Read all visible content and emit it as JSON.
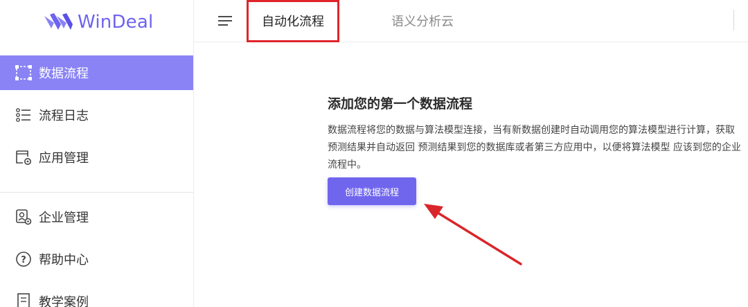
{
  "brand": {
    "name": "WinDeal",
    "color": "#6c63f0"
  },
  "sidebar": {
    "items": [
      {
        "label": "数据流程",
        "icon": "data-flow-icon",
        "active": true
      },
      {
        "label": "流程日志",
        "icon": "list-log-icon",
        "active": false
      },
      {
        "label": "应用管理",
        "icon": "app-settings-icon",
        "active": false
      },
      {
        "label": "企业管理",
        "icon": "enterprise-settings-icon",
        "active": false
      },
      {
        "label": "帮助中心",
        "icon": "help-icon",
        "active": false
      },
      {
        "label": "教学案例",
        "icon": "document-icon",
        "active": false
      }
    ],
    "active_color": "#8a83f5"
  },
  "header": {
    "tabs": [
      {
        "label": "自动化流程",
        "active": true
      },
      {
        "label": "语义分析云",
        "active": false
      }
    ],
    "highlight_color": "#e0242a"
  },
  "main": {
    "heading": "添加您的第一个数据流程",
    "description": "数据流程将您的数据与算法模型连接，当有新数据创建时自动调用您的算法模型进行计算，获取预测结果并自动返回 预测结果到您的数据库或者第三方应用中，以便将算法模型 应该到您的企业流程中。",
    "create_button": "创建数据流程",
    "button_color": "#7066ee",
    "annotation_arrow_color": "#d9262b"
  }
}
